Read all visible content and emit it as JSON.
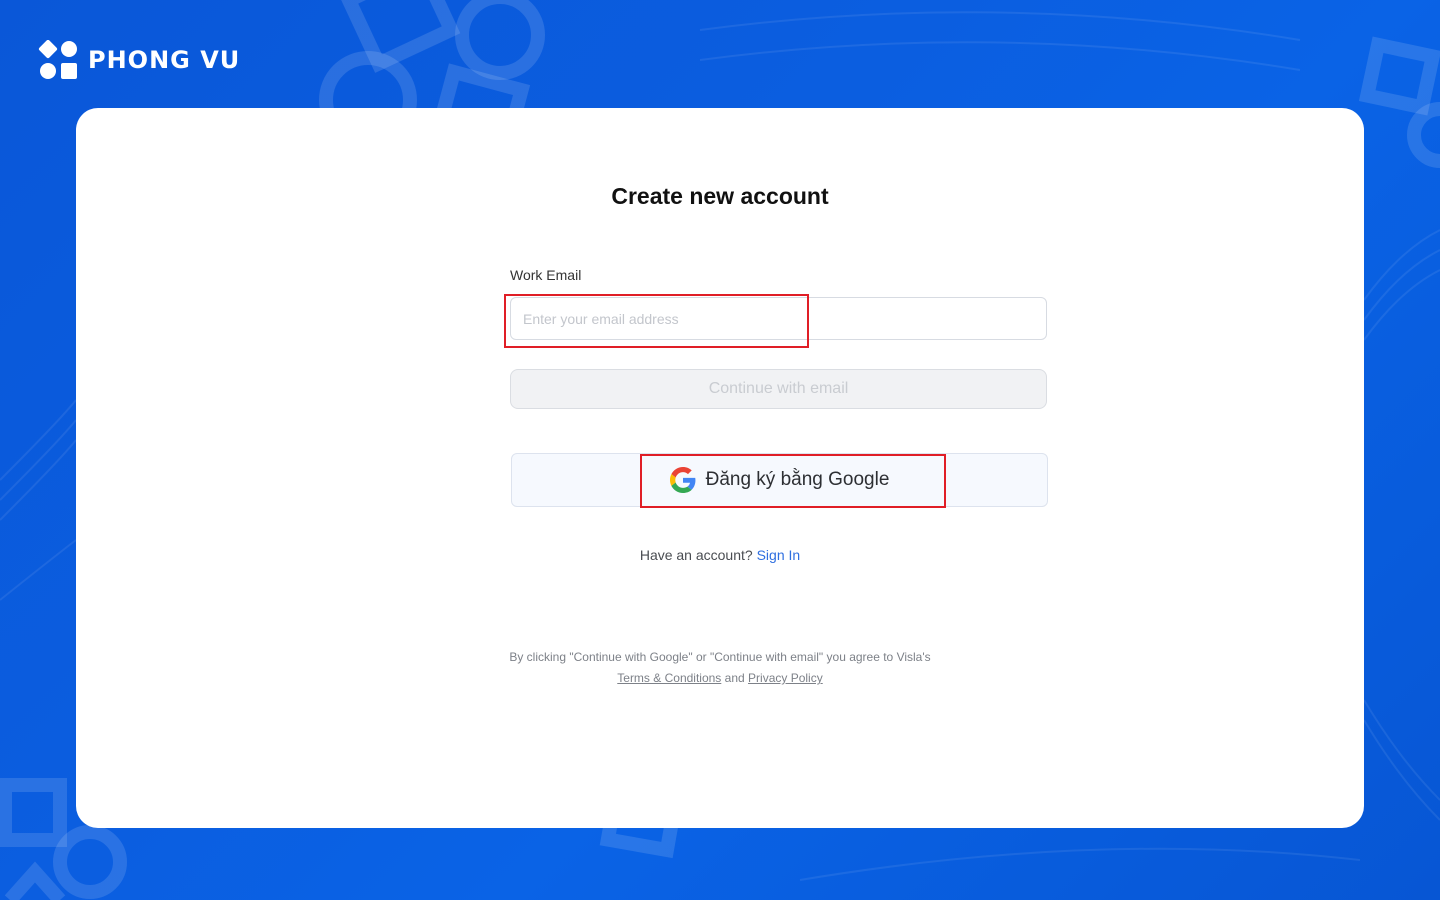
{
  "brand": {
    "name": "PHONG VU"
  },
  "colors": {
    "background": "#0a5ddf",
    "card": "#ffffff",
    "highlight": "#e01e26",
    "link": "#2f6fe0"
  },
  "signup": {
    "title": "Create new account",
    "email_label": "Work Email",
    "email_placeholder": "Enter your email address",
    "email_value": "",
    "continue_label": "Continue with email",
    "google_label": "Đăng ký bằng Google",
    "google_icon": "google-g-icon",
    "have_account_text": "Have an account?",
    "sign_in_label": "Sign In",
    "legal_line1": "By clicking \"Continue with Google\" or \"Continue with email\" you agree to Visla's",
    "terms_label": "Terms & Conditions",
    "and_text": "and",
    "privacy_label": "Privacy Policy"
  }
}
